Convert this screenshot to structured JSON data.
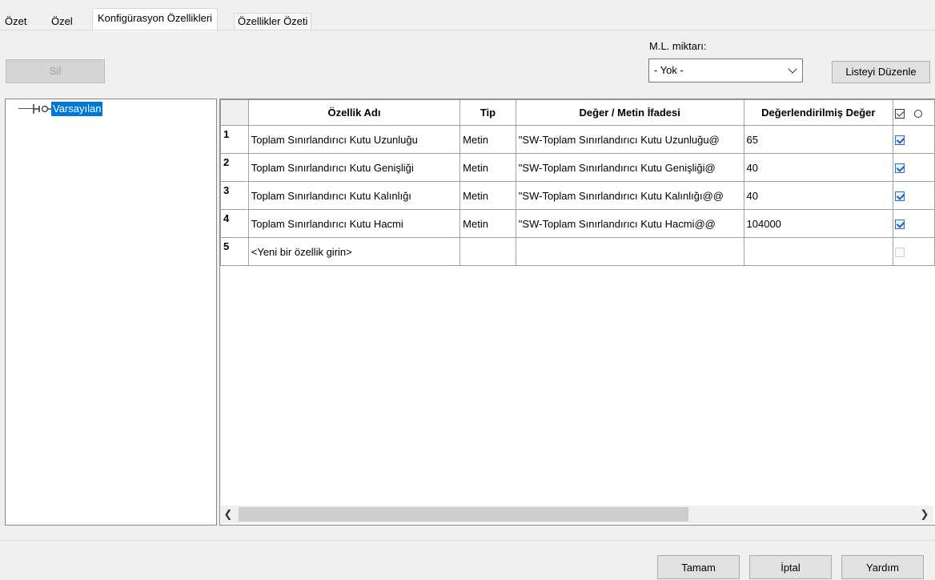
{
  "tabs": [
    {
      "label": "Özet",
      "active": false
    },
    {
      "label": "Özel",
      "active": false
    },
    {
      "label": "Konfigürasyon Özellikleri",
      "active": true
    },
    {
      "label": "Özellikler Özeti",
      "active": false
    }
  ],
  "toolbar": {
    "delete_label": "Sil",
    "bom_qty_label": "M.L. miktarı:",
    "bom_qty_value": "- Yok -",
    "edit_list_label": "Listeyi Düzenle"
  },
  "tree": {
    "node_label": "Varsayılan"
  },
  "grid": {
    "headers": {
      "name": "Özellik Adı",
      "type": "Tip",
      "value": "Değer / Metin İfadesi",
      "evaluated": "Değerlendirilmiş Değer"
    },
    "rows": [
      {
        "num": "1",
        "name": "Toplam Sınırlandırıcı Kutu Uzunluğu",
        "type": "Metin",
        "value": "\"SW-Toplam Sınırlandırıcı Kutu Uzunluğu@",
        "evaluated": "65",
        "checked": true
      },
      {
        "num": "2",
        "name": "Toplam Sınırlandırıcı Kutu Genişliği",
        "type": "Metin",
        "value": "\"SW-Toplam Sınırlandırıcı Kutu Genişliği@",
        "evaluated": "40",
        "checked": true
      },
      {
        "num": "3",
        "name": "Toplam Sınırlandırıcı Kutu Kalınlığı",
        "type": "Metin",
        "value": "\"SW-Toplam Sınırlandırıcı Kutu Kalınlığı@@",
        "evaluated": "40",
        "checked": true
      },
      {
        "num": "4",
        "name": "Toplam Sınırlandırıcı Kutu Hacmi",
        "type": "Metin",
        "value": "\"SW-Toplam Sınırlandırıcı Kutu Hacmi@@",
        "evaluated": "104000",
        "checked": true
      },
      {
        "num": "5",
        "name": "<Yeni bir özellik girin>",
        "type": "",
        "value": "",
        "evaluated": "",
        "checked": false
      }
    ]
  },
  "footer": {
    "ok_label": "Tamam",
    "cancel_label": "İptal",
    "help_label": "Yardım"
  }
}
